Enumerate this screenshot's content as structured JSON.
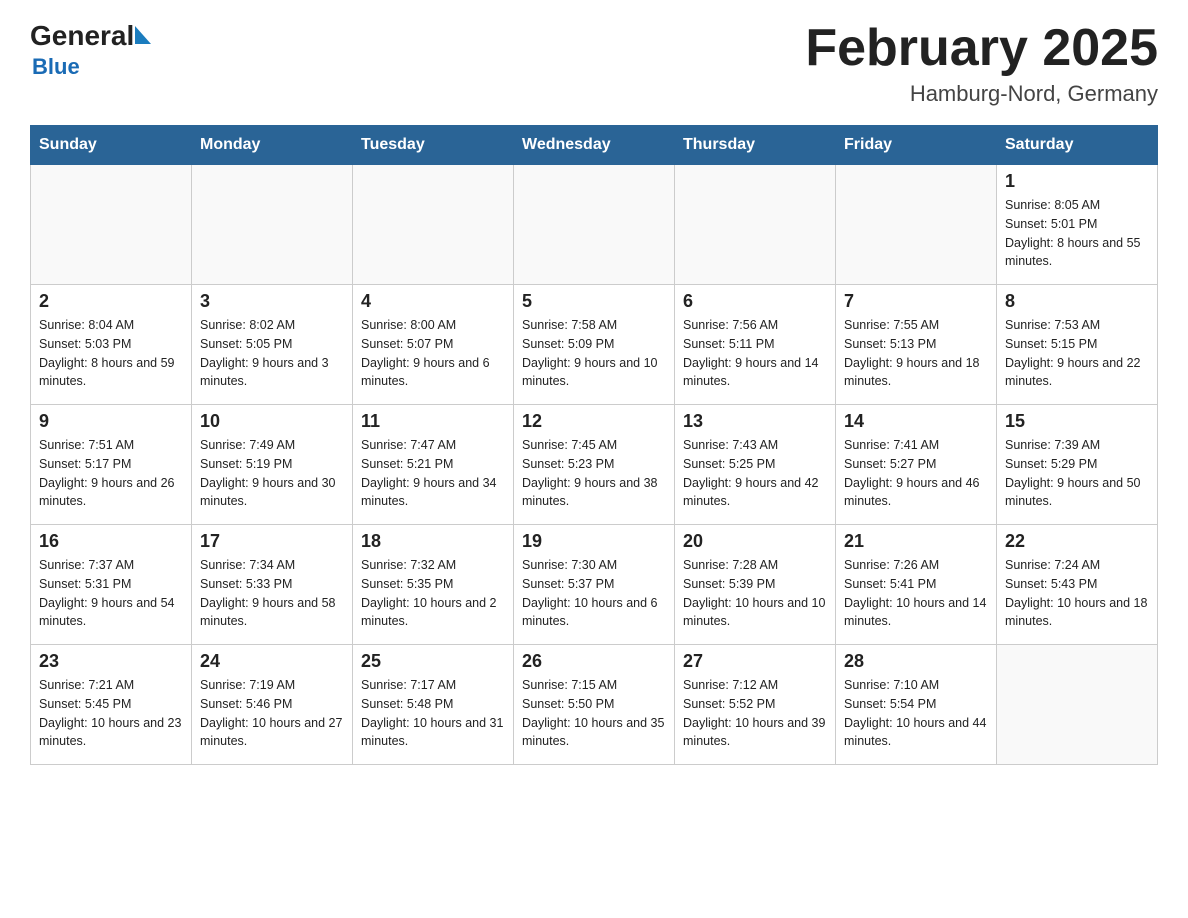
{
  "header": {
    "logo_general": "General",
    "logo_blue": "Blue",
    "month_title": "February 2025",
    "location": "Hamburg-Nord, Germany"
  },
  "weekdays": [
    "Sunday",
    "Monday",
    "Tuesday",
    "Wednesday",
    "Thursday",
    "Friday",
    "Saturday"
  ],
  "weeks": [
    [
      {
        "day": "",
        "sunrise": "",
        "sunset": "",
        "daylight": ""
      },
      {
        "day": "",
        "sunrise": "",
        "sunset": "",
        "daylight": ""
      },
      {
        "day": "",
        "sunrise": "",
        "sunset": "",
        "daylight": ""
      },
      {
        "day": "",
        "sunrise": "",
        "sunset": "",
        "daylight": ""
      },
      {
        "day": "",
        "sunrise": "",
        "sunset": "",
        "daylight": ""
      },
      {
        "day": "",
        "sunrise": "",
        "sunset": "",
        "daylight": ""
      },
      {
        "day": "1",
        "sunrise": "Sunrise: 8:05 AM",
        "sunset": "Sunset: 5:01 PM",
        "daylight": "Daylight: 8 hours and 55 minutes."
      }
    ],
    [
      {
        "day": "2",
        "sunrise": "Sunrise: 8:04 AM",
        "sunset": "Sunset: 5:03 PM",
        "daylight": "Daylight: 8 hours and 59 minutes."
      },
      {
        "day": "3",
        "sunrise": "Sunrise: 8:02 AM",
        "sunset": "Sunset: 5:05 PM",
        "daylight": "Daylight: 9 hours and 3 minutes."
      },
      {
        "day": "4",
        "sunrise": "Sunrise: 8:00 AM",
        "sunset": "Sunset: 5:07 PM",
        "daylight": "Daylight: 9 hours and 6 minutes."
      },
      {
        "day": "5",
        "sunrise": "Sunrise: 7:58 AM",
        "sunset": "Sunset: 5:09 PM",
        "daylight": "Daylight: 9 hours and 10 minutes."
      },
      {
        "day": "6",
        "sunrise": "Sunrise: 7:56 AM",
        "sunset": "Sunset: 5:11 PM",
        "daylight": "Daylight: 9 hours and 14 minutes."
      },
      {
        "day": "7",
        "sunrise": "Sunrise: 7:55 AM",
        "sunset": "Sunset: 5:13 PM",
        "daylight": "Daylight: 9 hours and 18 minutes."
      },
      {
        "day": "8",
        "sunrise": "Sunrise: 7:53 AM",
        "sunset": "Sunset: 5:15 PM",
        "daylight": "Daylight: 9 hours and 22 minutes."
      }
    ],
    [
      {
        "day": "9",
        "sunrise": "Sunrise: 7:51 AM",
        "sunset": "Sunset: 5:17 PM",
        "daylight": "Daylight: 9 hours and 26 minutes."
      },
      {
        "day": "10",
        "sunrise": "Sunrise: 7:49 AM",
        "sunset": "Sunset: 5:19 PM",
        "daylight": "Daylight: 9 hours and 30 minutes."
      },
      {
        "day": "11",
        "sunrise": "Sunrise: 7:47 AM",
        "sunset": "Sunset: 5:21 PM",
        "daylight": "Daylight: 9 hours and 34 minutes."
      },
      {
        "day": "12",
        "sunrise": "Sunrise: 7:45 AM",
        "sunset": "Sunset: 5:23 PM",
        "daylight": "Daylight: 9 hours and 38 minutes."
      },
      {
        "day": "13",
        "sunrise": "Sunrise: 7:43 AM",
        "sunset": "Sunset: 5:25 PM",
        "daylight": "Daylight: 9 hours and 42 minutes."
      },
      {
        "day": "14",
        "sunrise": "Sunrise: 7:41 AM",
        "sunset": "Sunset: 5:27 PM",
        "daylight": "Daylight: 9 hours and 46 minutes."
      },
      {
        "day": "15",
        "sunrise": "Sunrise: 7:39 AM",
        "sunset": "Sunset: 5:29 PM",
        "daylight": "Daylight: 9 hours and 50 minutes."
      }
    ],
    [
      {
        "day": "16",
        "sunrise": "Sunrise: 7:37 AM",
        "sunset": "Sunset: 5:31 PM",
        "daylight": "Daylight: 9 hours and 54 minutes."
      },
      {
        "day": "17",
        "sunrise": "Sunrise: 7:34 AM",
        "sunset": "Sunset: 5:33 PM",
        "daylight": "Daylight: 9 hours and 58 minutes."
      },
      {
        "day": "18",
        "sunrise": "Sunrise: 7:32 AM",
        "sunset": "Sunset: 5:35 PM",
        "daylight": "Daylight: 10 hours and 2 minutes."
      },
      {
        "day": "19",
        "sunrise": "Sunrise: 7:30 AM",
        "sunset": "Sunset: 5:37 PM",
        "daylight": "Daylight: 10 hours and 6 minutes."
      },
      {
        "day": "20",
        "sunrise": "Sunrise: 7:28 AM",
        "sunset": "Sunset: 5:39 PM",
        "daylight": "Daylight: 10 hours and 10 minutes."
      },
      {
        "day": "21",
        "sunrise": "Sunrise: 7:26 AM",
        "sunset": "Sunset: 5:41 PM",
        "daylight": "Daylight: 10 hours and 14 minutes."
      },
      {
        "day": "22",
        "sunrise": "Sunrise: 7:24 AM",
        "sunset": "Sunset: 5:43 PM",
        "daylight": "Daylight: 10 hours and 18 minutes."
      }
    ],
    [
      {
        "day": "23",
        "sunrise": "Sunrise: 7:21 AM",
        "sunset": "Sunset: 5:45 PM",
        "daylight": "Daylight: 10 hours and 23 minutes."
      },
      {
        "day": "24",
        "sunrise": "Sunrise: 7:19 AM",
        "sunset": "Sunset: 5:46 PM",
        "daylight": "Daylight: 10 hours and 27 minutes."
      },
      {
        "day": "25",
        "sunrise": "Sunrise: 7:17 AM",
        "sunset": "Sunset: 5:48 PM",
        "daylight": "Daylight: 10 hours and 31 minutes."
      },
      {
        "day": "26",
        "sunrise": "Sunrise: 7:15 AM",
        "sunset": "Sunset: 5:50 PM",
        "daylight": "Daylight: 10 hours and 35 minutes."
      },
      {
        "day": "27",
        "sunrise": "Sunrise: 7:12 AM",
        "sunset": "Sunset: 5:52 PM",
        "daylight": "Daylight: 10 hours and 39 minutes."
      },
      {
        "day": "28",
        "sunrise": "Sunrise: 7:10 AM",
        "sunset": "Sunset: 5:54 PM",
        "daylight": "Daylight: 10 hours and 44 minutes."
      },
      {
        "day": "",
        "sunrise": "",
        "sunset": "",
        "daylight": ""
      }
    ]
  ]
}
